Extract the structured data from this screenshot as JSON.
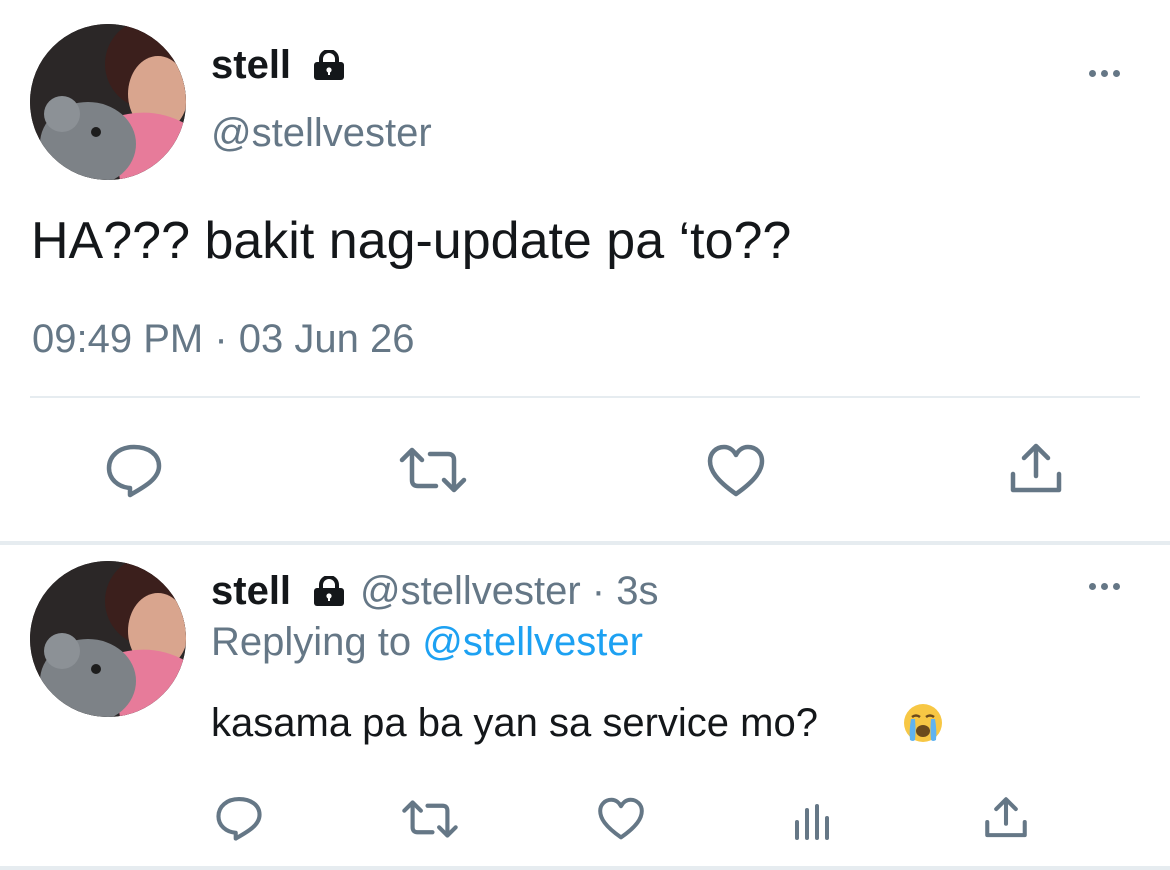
{
  "main_tweet": {
    "display_name": "stell",
    "handle": "@stellvester",
    "text": "HA??? bakit nag-update pa ‘to??",
    "timestamp": "09:49 PM · 03 Jun 26",
    "actions": [
      "reply-icon",
      "retweet-icon",
      "like-icon",
      "share-icon"
    ]
  },
  "reply_tweet": {
    "display_name": "stell",
    "handle": "@stellvester",
    "separator": "·",
    "age": "3s",
    "replying_prefix": "Replying to",
    "replying_handle": "@stellvester",
    "text": "kasama pa ba yan sa service mo?",
    "emoji": "😭",
    "actions": [
      "reply-icon",
      "retweet-icon",
      "like-icon",
      "analytics-icon",
      "share-icon"
    ]
  },
  "colors": {
    "text": "#14171a",
    "secondary": "#657786",
    "link": "#1da1f2",
    "divider": "#e6ecf0"
  }
}
